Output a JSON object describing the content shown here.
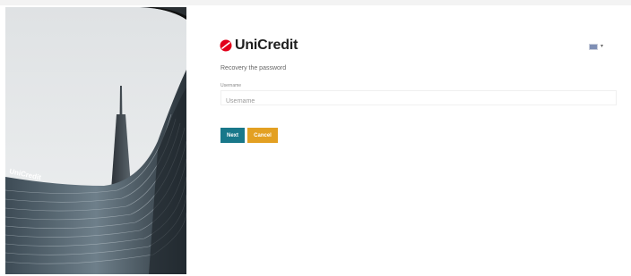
{
  "brand": {
    "name": "UniCredit",
    "color": "#e2001a"
  },
  "language": {
    "flag_icon": "uk-flag-icon",
    "caret_icon": "chevron-down-icon"
  },
  "form": {
    "title": "Recovery the password",
    "username_label": "Username",
    "username_placeholder": "Username",
    "username_value": ""
  },
  "buttons": {
    "next_label": "Next",
    "cancel_label": "Cancel",
    "next_color": "#19788a",
    "cancel_color": "#e3a022"
  },
  "photo": {
    "building_sign": "UniCredit"
  }
}
